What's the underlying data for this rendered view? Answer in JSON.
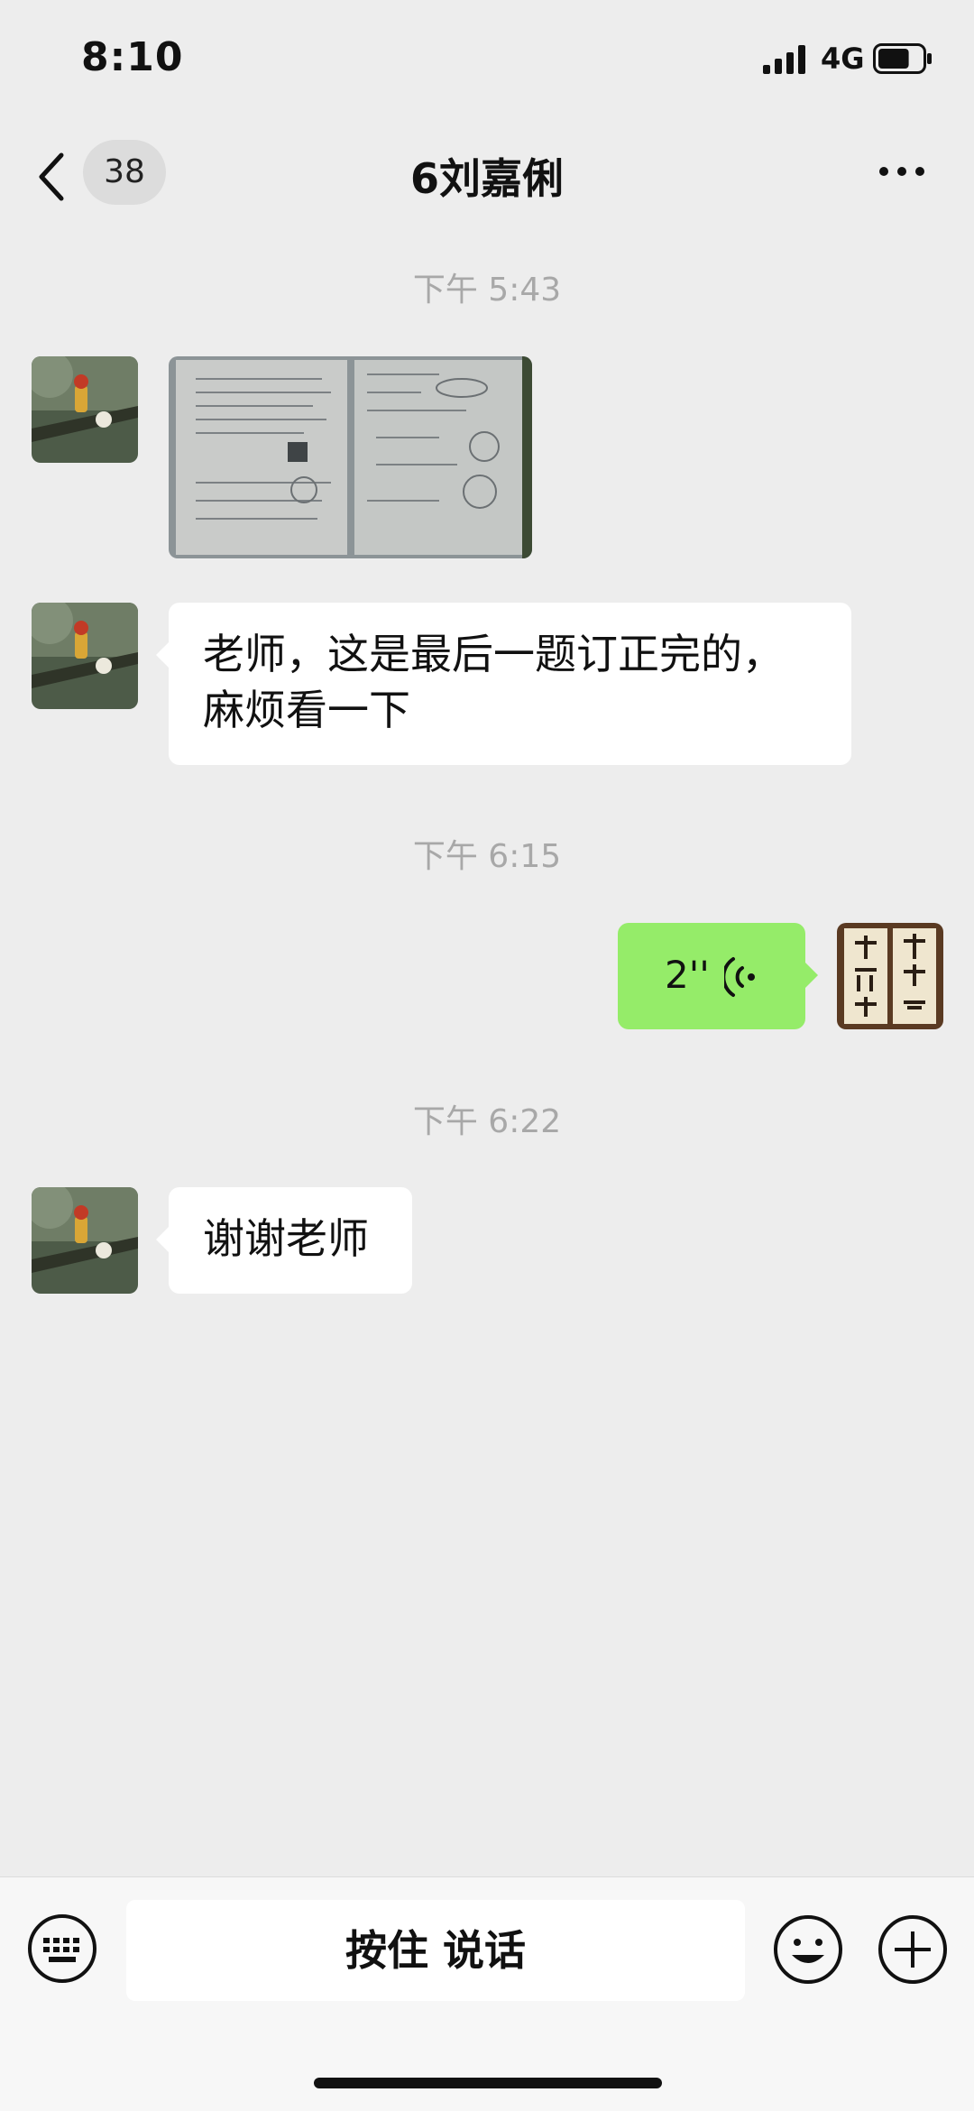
{
  "status_bar": {
    "time": "8:10",
    "network": "4G",
    "battery_level": 0.7
  },
  "nav": {
    "unread_count": "38",
    "title": "6刘嘉俐"
  },
  "messages": [
    {
      "timestamp": "下午 5:43",
      "type": "image",
      "sender": "contact"
    },
    {
      "type": "text",
      "sender": "contact",
      "lines": [
        "老师，这是最后一题订正完的，",
        "麻烦看一下"
      ]
    },
    {
      "timestamp": "下午 6:15",
      "type": "voice",
      "sender": "me",
      "duration": "2''"
    },
    {
      "timestamp": "下午 6:22",
      "type": "text",
      "sender": "contact",
      "text": "谢谢老师"
    }
  ],
  "input_bar": {
    "hold_to_talk_label": "按住 说话"
  },
  "colors": {
    "background": "#ededed",
    "my_bubble": "#95ec69",
    "their_bubble": "#ffffff",
    "timestamp": "#a8a8a8"
  }
}
